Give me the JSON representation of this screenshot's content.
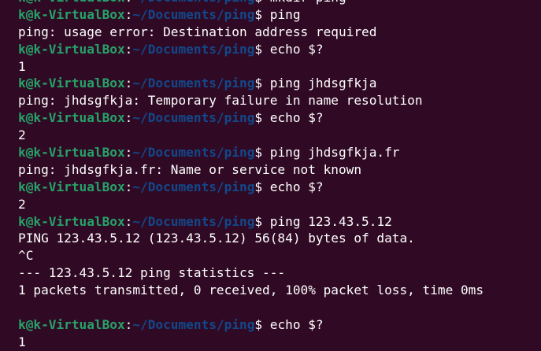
{
  "terminal": {
    "prompt": {
      "user_host": "k@k-VirtualBox",
      "colon": ":",
      "path": "~/Documents/ping",
      "symbol": "$ "
    },
    "lines": [
      {
        "kind": "prompt",
        "command": "mkdir ping"
      },
      {
        "kind": "prompt",
        "command": "ping"
      },
      {
        "kind": "output",
        "text": "ping: usage error: Destination address required"
      },
      {
        "kind": "prompt",
        "command": "echo $?"
      },
      {
        "kind": "output",
        "text": "1"
      },
      {
        "kind": "prompt",
        "command": "ping jhdsgfkja"
      },
      {
        "kind": "output",
        "text": "ping: jhdsgfkja: Temporary failure in name resolution"
      },
      {
        "kind": "prompt",
        "command": "echo $?"
      },
      {
        "kind": "output",
        "text": "2"
      },
      {
        "kind": "prompt",
        "command": "ping jhdsgfkja.fr"
      },
      {
        "kind": "output",
        "text": "ping: jhdsgfkja.fr: Name or service not known"
      },
      {
        "kind": "prompt",
        "command": "echo $?"
      },
      {
        "kind": "output",
        "text": "2"
      },
      {
        "kind": "prompt",
        "command": "ping 123.43.5.12"
      },
      {
        "kind": "output",
        "text": "PING 123.43.5.12 (123.43.5.12) 56(84) bytes of data."
      },
      {
        "kind": "output",
        "text": "^C"
      },
      {
        "kind": "output",
        "text": "--- 123.43.5.12 ping statistics ---"
      },
      {
        "kind": "output",
        "text": "1 packets transmitted, 0 received, 100% packet loss, time 0ms"
      },
      {
        "kind": "output",
        "text": ""
      },
      {
        "kind": "prompt",
        "command": "echo $?"
      },
      {
        "kind": "output",
        "text": "1"
      }
    ]
  }
}
